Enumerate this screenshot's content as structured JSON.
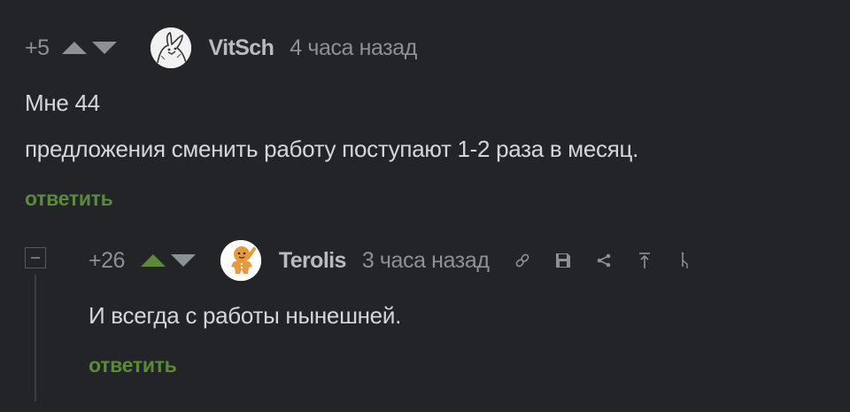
{
  "comments": [
    {
      "rating": "+5",
      "username": "VitSch",
      "time": "4 часа назад",
      "lines": [
        "Мне 44",
        "предложения сменить работу поступают 1-2 раза в месяц."
      ],
      "reply_label": "ответить",
      "avatar_icon": "sketch-avatar-icon"
    },
    {
      "rating": "+26",
      "username": "Terolis",
      "time": "3 часа назад",
      "lines": [
        "И всегда с работы нынешней."
      ],
      "reply_label": "ответить",
      "avatar_icon": "gingerbread-avatar-icon",
      "actions": [
        "link-icon",
        "save-icon",
        "share-icon",
        "scroll-top-icon",
        "jump-icon"
      ]
    }
  ],
  "colors": {
    "background": "#222427",
    "text": "#d4d6d8",
    "muted": "#8c9196",
    "accent_green": "#5b8a3a"
  }
}
